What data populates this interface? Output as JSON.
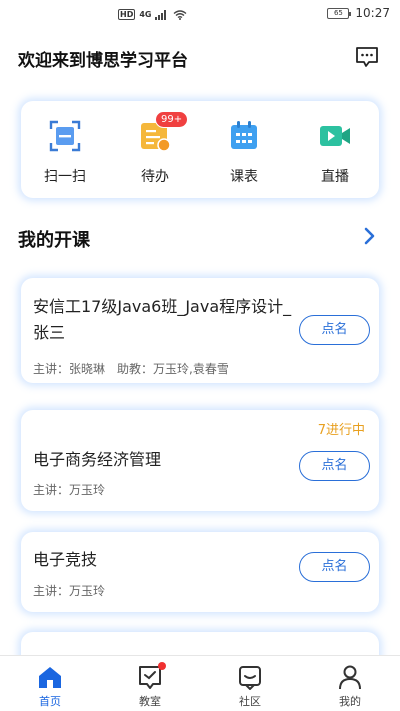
{
  "statusbar": {
    "hd": "HD",
    "signal": "4G",
    "battery": "65",
    "time": "10:27"
  },
  "header": {
    "title": "欢迎来到博思学习平台"
  },
  "quick_menu": {
    "scan_label": "扫一扫",
    "todo_label": "待办",
    "todo_badge": "99+",
    "schedule_label": "课表",
    "live_label": "直播"
  },
  "section": {
    "title": "我的开课"
  },
  "courses": [
    {
      "name": "安信工17级Java6班_Java程序设计_张三",
      "teacher": "主讲：张晓琳　助教：万玉玲,袁春雪",
      "status": "",
      "action": "点名"
    },
    {
      "name": "电子商务经济管理",
      "teacher": "主讲：万玉玲",
      "status": "7进行中",
      "action": "点名"
    },
    {
      "name": "电子竞技",
      "teacher": "主讲：万玉玲",
      "status": "",
      "action": "点名"
    }
  ],
  "bottom_nav": {
    "home": "首页",
    "classroom": "教室",
    "community": "社区",
    "profile": "我的"
  },
  "colors": {
    "accent": "#1a66e0",
    "status": "#e8a020",
    "badge": "#f04040"
  }
}
